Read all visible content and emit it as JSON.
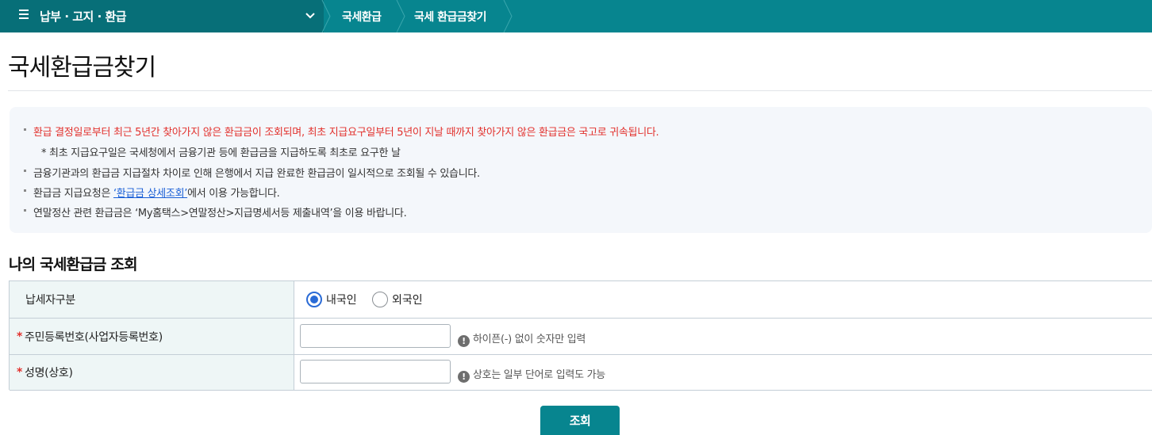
{
  "nav": {
    "menu_title": "납부 · 고지 · 환급",
    "crumbs": [
      "국세환급",
      "국세 환급금찾기"
    ]
  },
  "page_title": "국세환급금찾기",
  "notice": {
    "line1": "환급 결정일로부터 최근 5년간 찾아가지 않은 환급금이 조회되며, 최초 지급요구일부터 5년이 지날 때까지 찾아가지 않은 환급금은 국고로 귀속됩니다.",
    "line2": "* 최초 지급요구일은 국세청에서 금융기관 등에 환급금을 지급하도록 최초로 요구한 날",
    "line3": "금융기관과의 환급금 지급절차 차이로 인해 은행에서 지급 완료한 환급금이 일시적으로 조회될 수 있습니다.",
    "line4_prefix": "환급금 지급요청은 ",
    "line4_link": "‘환급금 상세조회’",
    "line4_suffix": "에서 이용 가능합니다.",
    "line5": "연말정산 관련 환급금은 ‘My홈택스>연말정산>지급명세서등 제출내역’을 이용 바랍니다."
  },
  "section_title": "나의 국세환급금 조회",
  "form": {
    "taxpayer_type": {
      "label": "납세자구분",
      "options": [
        "내국인",
        "외국인"
      ],
      "selected": "내국인"
    },
    "id_number": {
      "required_mark": "*",
      "label": "주민등록번호(사업자등록번호)",
      "value": "",
      "hint_icon": "!",
      "hint": "하이픈(-) 없이 숫자만 입력"
    },
    "name": {
      "required_mark": "*",
      "label": "성명(상호)",
      "value": "",
      "hint_icon": "!",
      "hint": "상호는 일부 단어로 입력도 가능"
    }
  },
  "submit_label": "조회",
  "colors": {
    "brand": "#07858f",
    "brand_dark": "#076f78",
    "alert_red": "#e2302c",
    "link_blue": "#1a5fd6",
    "radio_blue": "#2a6bd6"
  },
  "icons": [
    "hamburger-icon",
    "chevron-down-icon",
    "breadcrumb-separator-icon",
    "info-icon"
  ]
}
